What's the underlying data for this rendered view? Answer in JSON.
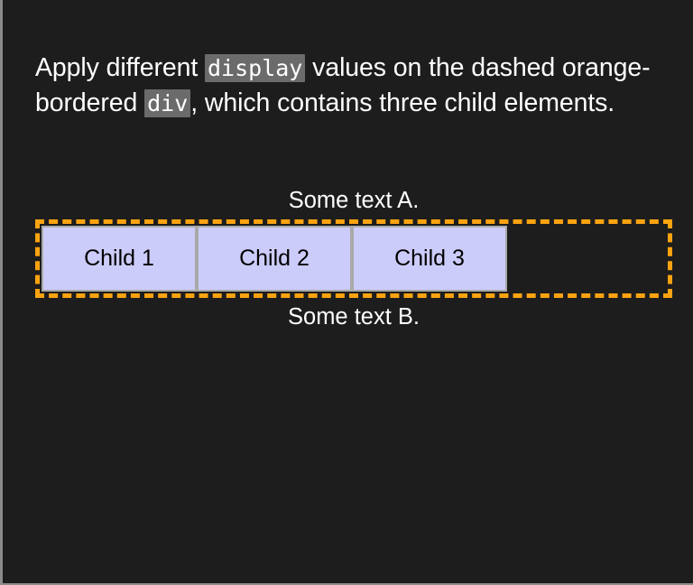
{
  "page": {
    "background_color": "#1d1d1d",
    "text_color": "#ffffff"
  },
  "intro": {
    "part1": "Apply different ",
    "code1": "display",
    "part2": " values on the dashed orange-bordered ",
    "code2": "div",
    "part3": ", which contains three child elements.",
    "code_background_color": "#6b6b6b"
  },
  "demo": {
    "text_a": "Some text A.",
    "text_b": "Some text B.",
    "container": {
      "border_color": "#fca311",
      "border_style": "dashed",
      "border_width_px": 5
    },
    "children": [
      {
        "label": "Child 1"
      },
      {
        "label": "Child 2"
      },
      {
        "label": "Child 3"
      }
    ],
    "child_style": {
      "background_color": "#ccccfa",
      "border_color": "#a9a9a9",
      "text_color": "#000000"
    }
  }
}
